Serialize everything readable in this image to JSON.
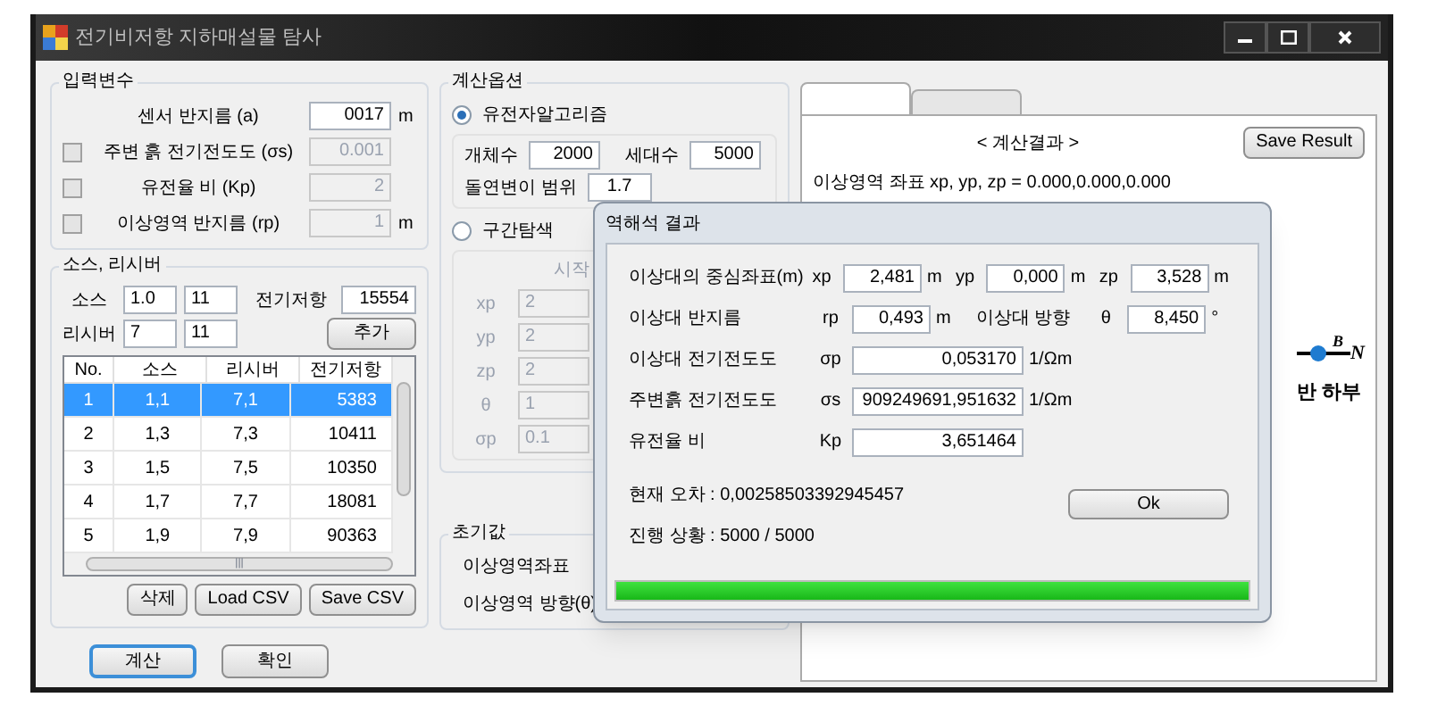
{
  "window": {
    "title": "전기비저항 지하매설물 탐사"
  },
  "input_params": {
    "title": "입력변수",
    "rows": [
      {
        "label": "센서 반지름 (a)",
        "value": "0017",
        "unit": "m",
        "disabled": false
      },
      {
        "label": "주변 흙 전기전도도 (σs)",
        "value": "0.001",
        "checked": false,
        "disabled": true
      },
      {
        "label": "유전율 비 (Kp)",
        "value": "2",
        "checked": false,
        "disabled": true
      },
      {
        "label": "이상영역 반지름 (rp)",
        "value": "1",
        "unit": "m",
        "checked": false,
        "disabled": true
      }
    ]
  },
  "source_receiver": {
    "title": "소스, 리시버",
    "source_label": "소스",
    "source_values": [
      "1.0",
      "11"
    ],
    "resistance_label": "전기저항",
    "resistance_value": "15554",
    "receiver_label": "리시버",
    "receiver_values": [
      "7",
      "11"
    ],
    "add_button": "추가",
    "table": {
      "columns": [
        "No.",
        "소스",
        "리시버",
        "전기저항"
      ],
      "rows": [
        {
          "cells": [
            "1",
            "1,1",
            "7,1",
            "5383"
          ],
          "selected": true
        },
        {
          "cells": [
            "2",
            "1,3",
            "7,3",
            "10411"
          ],
          "selected": false
        },
        {
          "cells": [
            "3",
            "1,5",
            "7,5",
            "10350"
          ],
          "selected": false
        },
        {
          "cells": [
            "4",
            "1,7",
            "7,7",
            "18081"
          ],
          "selected": false
        },
        {
          "cells": [
            "5",
            "1,9",
            "7,9",
            "90363"
          ],
          "selected": false
        }
      ],
      "scroll_mark": "|||"
    },
    "buttons": [
      "삭제",
      "Load CSV",
      "Save CSV"
    ]
  },
  "bottom_buttons": [
    {
      "label": "계산",
      "focused": true
    },
    {
      "label": "확인",
      "focused": false
    }
  ],
  "calc_options": {
    "title": "계산옵션",
    "options": [
      {
        "label": "유전자알고리즘",
        "selected": true,
        "kind": "genetic",
        "fields": [
          {
            "label": "개체수",
            "value": "2000"
          },
          {
            "label": "세대수",
            "value": "5000"
          },
          {
            "label": "돌연변이 범위",
            "value": "1.7"
          }
        ]
      },
      {
        "label": "구간탐색",
        "selected": false,
        "kind": "interval",
        "header": "시작",
        "rows": [
          {
            "symbol": "xp",
            "value": "2"
          },
          {
            "symbol": "yp",
            "value": "2"
          },
          {
            "symbol": "zp",
            "value": "2"
          },
          {
            "symbol": "θ",
            "value": "1"
          },
          {
            "symbol": "σp",
            "value": "0.1"
          }
        ]
      }
    ]
  },
  "initial_values": {
    "title": "초기값",
    "labels": [
      "이상영역좌표",
      "이상영역 방향(θ)"
    ]
  },
  "result_panel": {
    "tabs": [
      {
        "selected": true
      },
      {
        "selected": false
      }
    ],
    "heading": "< 계산결과 >",
    "save_button": "Save Result",
    "coords_line": "이상영역 좌표 xp, yp, zp = 0.000,0.000,0.000",
    "diagram": {
      "point_label": "B",
      "axis_label": "N",
      "caption": "반 하부"
    }
  },
  "dialog": {
    "title": "역해석 결과",
    "rows": [
      {
        "label": "이상대의 중심좌표(m)",
        "fields": [
          {
            "symbol": "xp",
            "value": "2,481",
            "unit": "m"
          },
          {
            "symbol": "yp",
            "value": "0,000",
            "unit": "m"
          },
          {
            "symbol": "zp",
            "value": "3,528",
            "unit": "m"
          }
        ]
      },
      {
        "label": "이상대 반지름",
        "fields": [
          {
            "symbol": "rp",
            "value": "0,493",
            "unit": "m"
          },
          {
            "pre_label": "이상대 방향",
            "symbol": "θ",
            "value": "8,450",
            "unit": "°"
          }
        ]
      },
      {
        "label": "이상대 전기전도도",
        "fields": [
          {
            "symbol": "σp",
            "value": "0,053170",
            "unit": "1/Ωm"
          }
        ]
      },
      {
        "label": "주변흙 전기전도도",
        "fields": [
          {
            "symbol": "σs",
            "value": "909249691,951632",
            "unit": "1/Ωm"
          }
        ]
      },
      {
        "label": "유전율 비",
        "fields": [
          {
            "symbol": "Kp",
            "value": "3,651464"
          }
        ]
      }
    ],
    "error_line": "현재 오차 : 0,00258503392945457",
    "progress_line": "진행 상황 : 5000 / 5000",
    "ok_button": "Ok",
    "progress": {
      "level": 1
    }
  }
}
